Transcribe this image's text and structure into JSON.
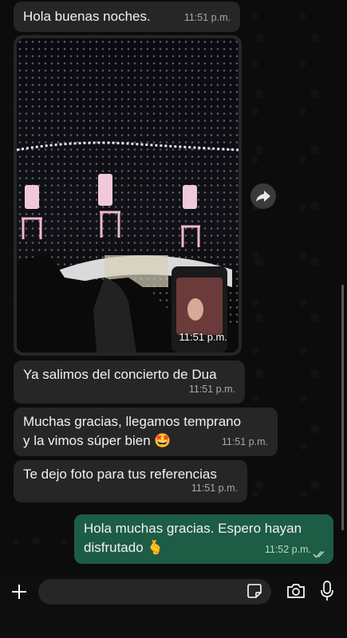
{
  "messages": [
    {
      "text": "Hola buenas noches.",
      "time": "11:51 p.m."
    },
    {
      "photo": true,
      "time": "11:51 p.m."
    },
    {
      "text": "Ya salimos del concierto de Dua",
      "time": "11:51 p.m."
    },
    {
      "text_line1": "Muchas gracias, llegamos temprano",
      "text_line2": "y la vimos súper bien 🤩",
      "time": "11:51 p.m."
    },
    {
      "text": "Te dejo foto para tus referencias",
      "time": "11:51 p.m."
    },
    {
      "text_line1": "Hola muchas gracias. Espero hayan",
      "text_line2": "disfrutado 🫰",
      "time": "11:52 p.m."
    }
  ],
  "icons": {
    "forward": "forward-arrow-icon",
    "add": "plus-icon",
    "sticker": "sticker-icon",
    "camera": "camera-icon",
    "mic": "microphone-icon",
    "read_receipt": "double-check-icon"
  },
  "colors": {
    "incoming_bubble": "#262626",
    "outgoing_bubble": "#1d5c45",
    "background": "#0c0c0c"
  }
}
